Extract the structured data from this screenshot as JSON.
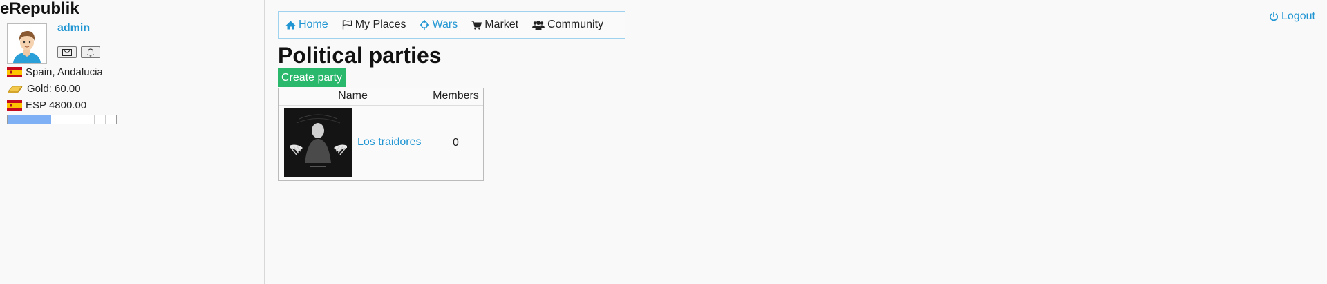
{
  "sidebar": {
    "app_title": "eRepublik",
    "username": "admin",
    "location": "Spain, Andalucia",
    "gold": "Gold: 60.00",
    "currency": "ESP 4800.00",
    "progress_fraction": 0.4
  },
  "nav": {
    "items": [
      {
        "label": "Home",
        "icon": "home-icon"
      },
      {
        "label": "My Places",
        "icon": "flag-icon"
      },
      {
        "label": "Wars",
        "icon": "crosshairs-icon"
      },
      {
        "label": "Market",
        "icon": "cart-icon"
      },
      {
        "label": "Community",
        "icon": "users-icon"
      }
    ],
    "logout": "Logout"
  },
  "main": {
    "title": "Political parties",
    "create_button": "Create party",
    "table": {
      "columns": [
        "Name",
        "Members"
      ],
      "rows": [
        {
          "name": "Los traidores",
          "members": "0"
        }
      ]
    }
  },
  "colors": {
    "link_blue": "#2196d3",
    "create_green": "#2ab86d",
    "progress_blue": "#7fb0f5",
    "nav_border": "#9fd2ee"
  }
}
